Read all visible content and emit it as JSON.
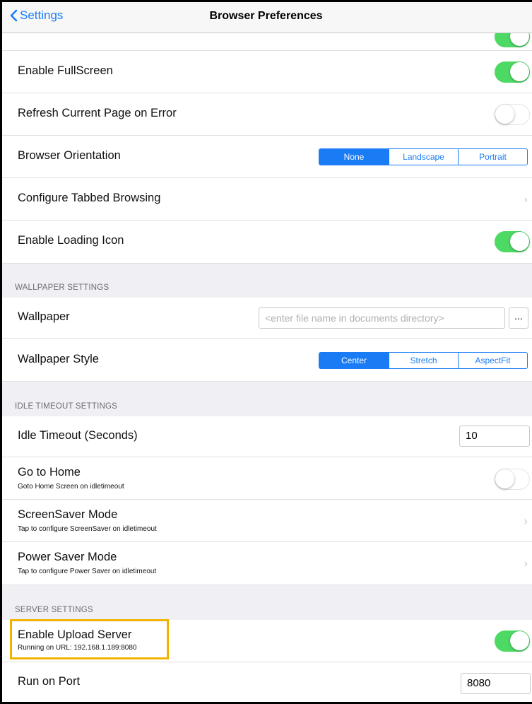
{
  "nav": {
    "back_label": "Settings",
    "title": "Browser Preferences"
  },
  "rows": {
    "fullscreen": "Enable FullScreen",
    "refresh": "Refresh Current Page on Error",
    "orientation": "Browser Orientation",
    "tabbed": "Configure Tabbed Browsing",
    "loading_icon": "Enable Loading Icon",
    "wallpaper": "Wallpaper",
    "wallpaper_style": "Wallpaper Style",
    "idle_timeout": "Idle Timeout (Seconds)",
    "go_home": "Go to Home",
    "go_home_sub": "Goto Home Screen on idletimeout",
    "screensaver": "ScreenSaver Mode",
    "screensaver_sub": "Tap to configure ScreenSaver on idletimeout",
    "power_saver": "Power Saver Mode",
    "power_saver_sub": "Tap to configure Power Saver on idletimeout",
    "upload_server": "Enable Upload Server",
    "upload_server_sub": "Running on URL: 192.168.1.189:8080",
    "run_port": "Run on Port"
  },
  "sections": {
    "wallpaper": "WALLPAPER SETTINGS",
    "idle": "IDLE TIMEOUT SETTINGS",
    "server": "SERVER SETTINGS"
  },
  "orientation_options": [
    "None",
    "Landscape",
    "Portrait"
  ],
  "wallpaper_style_options": [
    "Center",
    "Stretch",
    "AspectFit"
  ],
  "wallpaper_placeholder": "<enter file name in documents directory>",
  "browse_label": "...",
  "idle_timeout_value": "10",
  "port_value": "8080",
  "toggles": {
    "top": true,
    "fullscreen": true,
    "refresh": false,
    "loading_icon": true,
    "go_home": false,
    "upload_server": true
  },
  "colors": {
    "accent": "#1a7cf5",
    "toggle_on": "#4cd964",
    "highlight": "#f0b400"
  }
}
